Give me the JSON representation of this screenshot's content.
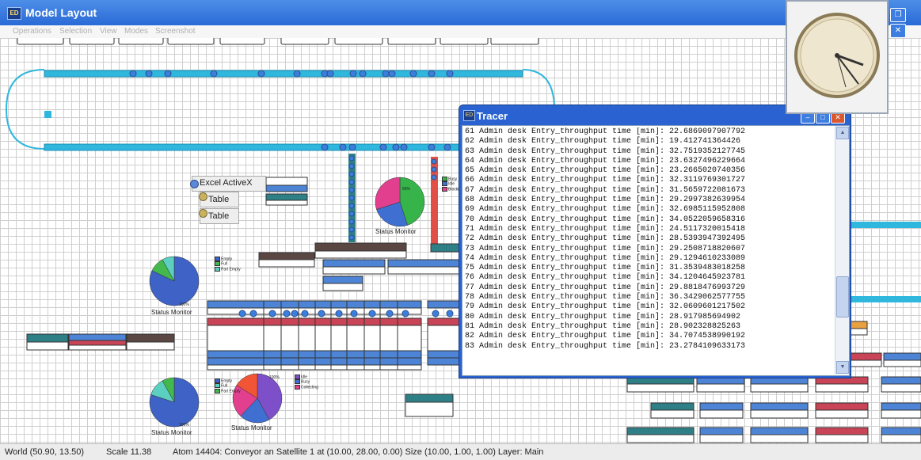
{
  "window": {
    "title": "Model Layout"
  },
  "menu": [
    "Operations",
    "Selection",
    "View",
    "Modes",
    "Screenshot"
  ],
  "tracer": {
    "title": "Tracer",
    "lines": [
      "61 Admin desk Entry_throughput time [min]: 22.6869097907792",
      "62 Admin desk Entry_throughput time [min]: 19.412741364426",
      "63 Admin desk Entry_throughput time [min]: 32.7519352127745",
      "64 Admin desk Entry_throughput time [min]: 23.6327496229664",
      "65 Admin desk Entry_throughput time [min]: 23.2665020740356",
      "66 Admin desk Entry_throughput time [min]: 32.3119769301727",
      "67 Admin desk Entry_throughput time [min]: 31.5659722081673",
      "68 Admin desk Entry_throughput time [min]: 29.2997382639954",
      "69 Admin desk Entry_throughput time [min]: 32.6985115952808",
      "70 Admin desk Entry_throughput time [min]: 34.0522059658316",
      "71 Admin desk Entry_throughput time [min]: 24.5117320015418",
      "72 Admin desk Entry_throughput time [min]: 28.5393947392495",
      "73 Admin desk Entry_throughput time [min]: 29.2508718820607",
      "74 Admin desk Entry_throughput time [min]: 29.1294610233089",
      "75 Admin desk Entry_throughput time [min]: 31.3539483018258",
      "76 Admin desk Entry_throughput time [min]: 34.1204645923781",
      "77 Admin desk Entry_throughput time [min]: 29.8818476993729",
      "78 Admin desk Entry_throughput time [min]: 36.3429062577755",
      "79 Admin desk Entry_throughput time [min]: 32.0609601217502",
      "80 Admin desk Entry_throughput time [min]: 28.917985694902",
      "81 Admin desk Entry_throughput time [min]: 28.902328825263",
      "82 Admin desk Entry_throughput time [min]: 34.7074538990192",
      "83 Admin desk Entry_throughput time [min]: 23.2784109633173"
    ]
  },
  "popup": {
    "header": "Excel ActiveX",
    "items": [
      "Table",
      "Table"
    ]
  },
  "status_monitors": [
    {
      "label": "Status Monitor",
      "pct": "56%",
      "slices": [
        {
          "value": 45,
          "color": "#36b44a"
        },
        {
          "value": 25,
          "color": "#3f6fd1"
        },
        {
          "value": 30,
          "color": "#e2408f"
        }
      ],
      "legend": [
        "Busy",
        "Idle",
        "Blocking"
      ]
    },
    {
      "label": "Status Monitor",
      "pct": "100%",
      "slices": [
        {
          "value": 82,
          "color": "#3e62c6"
        },
        {
          "value": 10,
          "color": "#43b84d"
        },
        {
          "value": 8,
          "color": "#5bd0c0"
        }
      ],
      "legend": [
        "Empty",
        "Full",
        "Part Empty"
      ]
    },
    {
      "label": "Status Monitor",
      "pct": "100%",
      "slices": [
        {
          "value": 80,
          "color": "#3e62c6"
        },
        {
          "value": 12,
          "color": "#5bd0c0"
        },
        {
          "value": 8,
          "color": "#43b84d"
        }
      ],
      "legend": [
        "Empty",
        "Full",
        "Part Empty"
      ]
    },
    {
      "label": "Status Monitor",
      "pct": "100%",
      "slices": [
        {
          "value": 42,
          "color": "#7d4fc8"
        },
        {
          "value": 20,
          "color": "#3f6fd1"
        },
        {
          "value": 22,
          "color": "#e2408f"
        },
        {
          "value": 16,
          "color": "#f25535"
        }
      ],
      "legend": [
        "Idle",
        "Busy",
        "Collecting"
      ]
    }
  ],
  "status_bar": {
    "world": "World (50.90, 13.50)",
    "scale": "Scale 11.38",
    "atom": "Atom 14404: Conveyor an Satellite 1 at (10.00, 28.00, 0.00) Size (10.00, 1.00, 1.00) Layer: Main"
  },
  "colors": {
    "conveyor": "#2fb7de",
    "queue_blue": "#4d84d6",
    "queue_red": "#c84456",
    "queue_teal": "#2f7f87",
    "queue_brown": "#5a4744",
    "selection_red": "#d9582f"
  }
}
